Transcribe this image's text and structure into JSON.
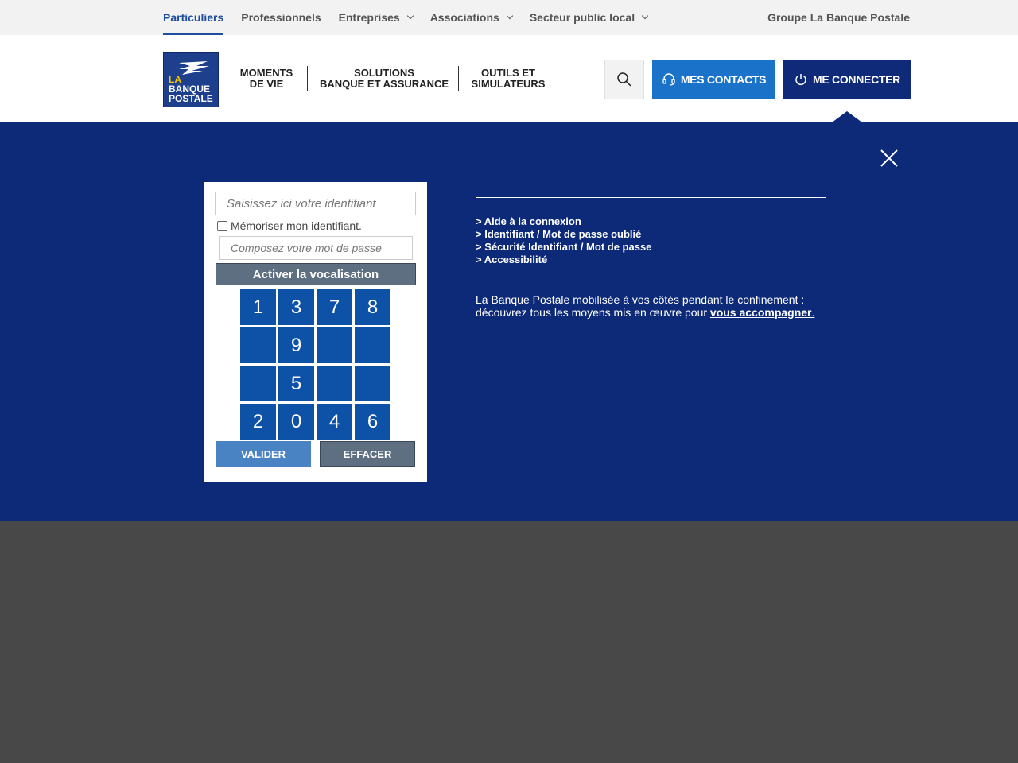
{
  "topnav": {
    "items": [
      {
        "label": "Particuliers",
        "active": true,
        "has_dropdown": false
      },
      {
        "label": "Professionnels",
        "active": false,
        "has_dropdown": false
      },
      {
        "label": "Entreprises",
        "active": false,
        "has_dropdown": true
      },
      {
        "label": "Associations",
        "active": false,
        "has_dropdown": true
      },
      {
        "label": "Secteur public local",
        "active": false,
        "has_dropdown": true
      }
    ],
    "groupe": "Groupe La Banque Postale"
  },
  "logo": {
    "line1": "LA",
    "line2": "BANQUE",
    "line3": "POSTALE"
  },
  "mainnav": {
    "items": [
      {
        "line1": "MOMENTS",
        "line2": "DE VIE"
      },
      {
        "line1": "SOLUTIONS",
        "line2": "BANQUE ET ASSURANCE"
      },
      {
        "line1": "OUTILS ET",
        "line2": "SIMULATEURS"
      }
    ]
  },
  "header": {
    "search_icon": "search-icon",
    "contacts_label": "MES CONTACTS",
    "connect_label": "ME CONNECTER"
  },
  "login": {
    "id_placeholder": "Saisissez ici votre identifiant",
    "remember_label": "Mémoriser mon identifiant.",
    "password_placeholder": "Composez votre mot de passe",
    "vocal_label": "Activer la vocalisation",
    "keys": [
      "1",
      "3",
      "7",
      "8",
      "",
      "9",
      "",
      "",
      "",
      "5",
      "",
      "",
      "2",
      "0",
      "4",
      "6"
    ],
    "validate_label": "VALIDER",
    "clear_label": "EFFACER"
  },
  "help": {
    "links": [
      "> Aide à la connexion",
      "> Identifiant / Mot de passe oublié",
      "> Sécurité Identifiant / Mot de passe",
      "> Accessibilité"
    ],
    "info_line1": "La Banque Postale mobilisée à vos côtés pendant le confinement :",
    "info_line2": "découvrez tous les moyens mis en œuvre pour ",
    "info_link": "vous accompagner",
    "info_end": "."
  },
  "colors": {
    "primary_blue": "#0c2a78",
    "contacts_blue": "#1a73c9",
    "key_blue": "#0e52a8",
    "grey_button": "#5f6f82",
    "active_nav": "#1f4e9c"
  }
}
